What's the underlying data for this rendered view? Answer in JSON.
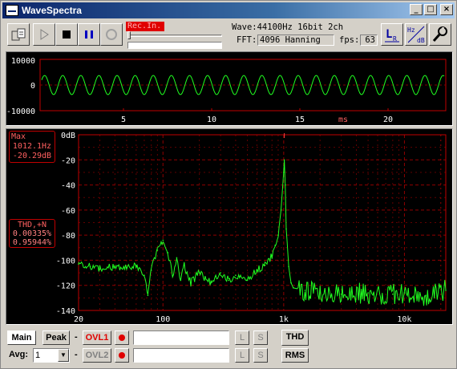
{
  "window": {
    "title": "WaveSpectra"
  },
  "toolbar": {
    "rec_label": "Rec.In.",
    "wave_info": "Wave:44100Hz 16bit 2ch",
    "fft_label": "FFT:",
    "fft_value": "4096 Hanning",
    "fps_label": "fps:",
    "fps_value": "63"
  },
  "scope": {
    "y_labels": [
      "10000",
      "0",
      "-10000"
    ],
    "x_labels": [
      "5",
      "10",
      "15",
      "ms",
      "20"
    ]
  },
  "spectrum": {
    "max_title": "Max",
    "max_freq": "1012.1Hz",
    "max_level": "-20.29dB",
    "thd_title": "THD,+N",
    "thd_value1": "0.00335%",
    "thd_value2": "0.95944%",
    "y_labels": [
      "0dB",
      "-20",
      "-40",
      "-60",
      "-80",
      "-100",
      "-120",
      "-140"
    ],
    "x_labels": [
      "20",
      "100",
      "1k",
      "10k"
    ]
  },
  "bottom": {
    "main_label": "Main",
    "peak_label": "Peak",
    "avg_label": "Avg:",
    "avg_value": "1",
    "ovl1_label": "OVL1",
    "ovl2_label": "OVL2",
    "l_label": "L",
    "s_label": "S",
    "thd_label": "THD",
    "rms_label": "RMS",
    "dash": "-"
  },
  "chart_data": {
    "type": "line",
    "title": "",
    "xlabel": "",
    "ylabel": "",
    "x_scale": "log",
    "xlim": [
      20,
      22000
    ],
    "ylim": [
      -140,
      0
    ],
    "grid": true,
    "series": [
      {
        "x": [
          20,
          25,
          30,
          40,
          50,
          60,
          70,
          75,
          80,
          90,
          100,
          110,
          120,
          130,
          140,
          150,
          170,
          200,
          250,
          300,
          350,
          400,
          500,
          600,
          700,
          800,
          850,
          900,
          950,
          1000,
          1012,
          1030,
          1050,
          1100,
          1150,
          1200,
          1500,
          2000,
          3000,
          5000,
          8000,
          10000,
          15000,
          22000
        ],
        "y": [
          -103,
          -105,
          -107,
          -105,
          -106,
          -104,
          -112,
          -128,
          -108,
          -92,
          -84,
          -94,
          -112,
          -98,
          -116,
          -104,
          -118,
          -110,
          -118,
          -110,
          -116,
          -112,
          -116,
          -108,
          -104,
          -96,
          -88,
          -80,
          -60,
          -30,
          -20,
          -40,
          -75,
          -105,
          -118,
          -122,
          -124,
          -126,
          -127,
          -126,
          -127,
          -126,
          -128,
          -124
        ]
      }
    ]
  }
}
